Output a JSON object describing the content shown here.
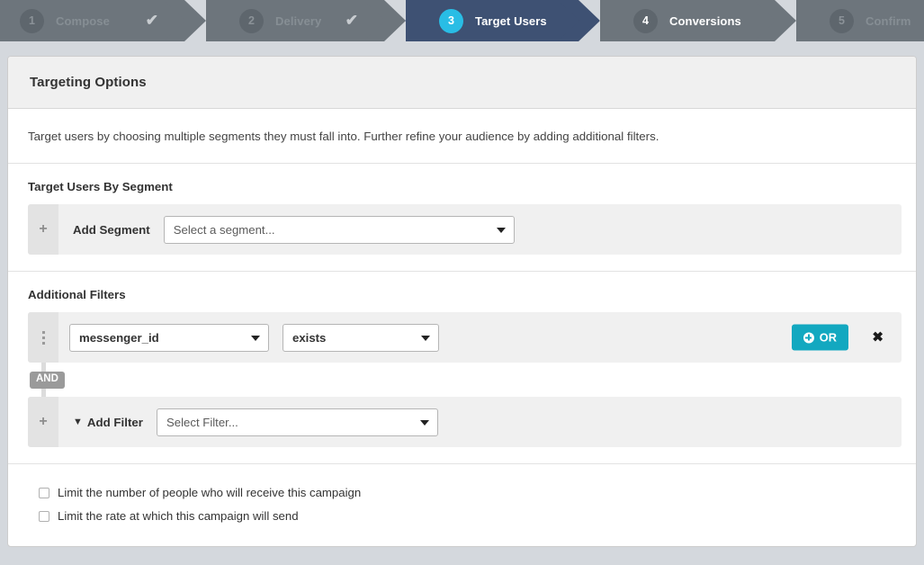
{
  "wizard": {
    "steps": [
      {
        "number": "1",
        "label": "Compose",
        "state": "complete",
        "check": "✔"
      },
      {
        "number": "2",
        "label": "Delivery",
        "state": "complete",
        "check": "✔"
      },
      {
        "number": "3",
        "label": "Target Users",
        "state": "active",
        "check": ""
      },
      {
        "number": "4",
        "label": "Conversions",
        "state": "upcoming",
        "check": ""
      },
      {
        "number": "5",
        "label": "Confirm",
        "state": "upcoming",
        "check": ""
      }
    ]
  },
  "card": {
    "title": "Targeting Options",
    "description": "Target users by choosing multiple segments they must fall into. Further refine your audience by adding additional filters."
  },
  "segment_section": {
    "heading": "Target Users By Segment",
    "add_label": "Add Segment",
    "plus": "+",
    "select_placeholder": "Select a segment..."
  },
  "filters_section": {
    "heading": "Additional Filters",
    "rows": [
      {
        "field_value": "messenger_id",
        "operator_value": "exists",
        "or_label": "OR",
        "close_label": "✖"
      }
    ],
    "connector_label": "AND",
    "add_filter_label": "Add Filter",
    "add_filter_icon": "▼",
    "add_plus": "+",
    "filter_placeholder": "Select Filter..."
  },
  "limits": {
    "options": [
      {
        "label": "Limit the number of people who will receive this campaign",
        "checked": false
      },
      {
        "label": "Limit the rate at which this campaign will send",
        "checked": false
      }
    ]
  },
  "colors": {
    "accent_teal": "#13a8c0",
    "active_step_bg": "#3e5173",
    "active_badge": "#29bde5",
    "step_bg": "#6d757c",
    "page_bg": "#d4d8dd"
  }
}
